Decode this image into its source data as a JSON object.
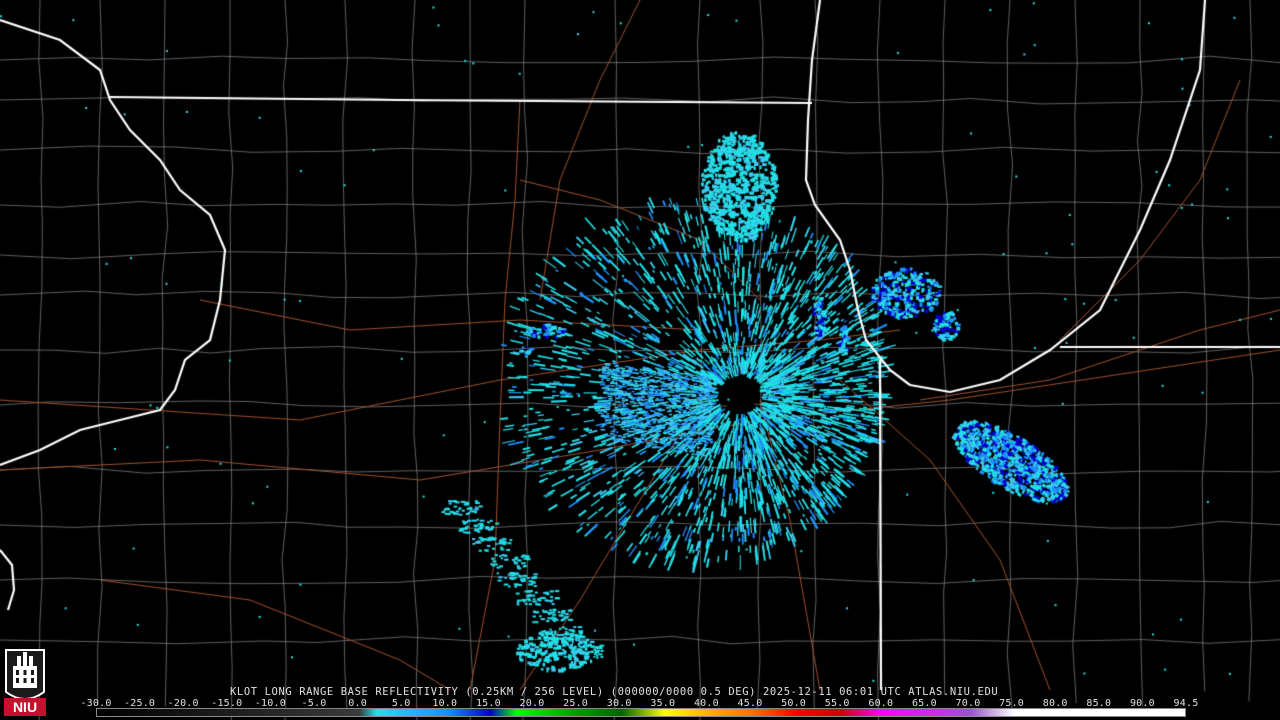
{
  "product": {
    "caption": "KLOT LONG RANGE BASE REFLECTIVITY (0.25KM / 256 LEVEL) (000000/0000 0.5 DEG) 2025-12-11 06:01 UTC  ATLAS.NIU.EDU"
  },
  "scale": {
    "ticks": [
      "-30.0",
      "-25.0",
      "-20.0",
      "-15.0",
      "-10.0",
      "-5.0",
      "0.0",
      "5.0",
      "10.0",
      "15.0",
      "20.0",
      "25.0",
      "30.0",
      "35.0",
      "40.0",
      "45.0",
      "50.0",
      "55.0",
      "60.0",
      "65.0",
      "70.0",
      "75.0",
      "80.0",
      "85.0",
      "90.0",
      "94.5"
    ],
    "stops": [
      {
        "dbz": -30,
        "color": "#000000"
      },
      {
        "dbz": 0,
        "color": "#3a3a3a"
      },
      {
        "dbz": 2,
        "color": "#22e0e8"
      },
      {
        "dbz": 10,
        "color": "#1e90ff"
      },
      {
        "dbz": 15,
        "color": "#0000cc"
      },
      {
        "dbz": 18,
        "color": "#00ff00"
      },
      {
        "dbz": 25,
        "color": "#009a00"
      },
      {
        "dbz": 30,
        "color": "#006400"
      },
      {
        "dbz": 35,
        "color": "#ffff00"
      },
      {
        "dbz": 40,
        "color": "#ffb000"
      },
      {
        "dbz": 45,
        "color": "#ff7000"
      },
      {
        "dbz": 50,
        "color": "#ff0000"
      },
      {
        "dbz": 55,
        "color": "#d00000"
      },
      {
        "dbz": 60,
        "color": "#ff00ff"
      },
      {
        "dbz": 70,
        "color": "#9955cc"
      },
      {
        "dbz": 75,
        "color": "#ffffff"
      },
      {
        "dbz": 94.5,
        "color": "#ffffff"
      }
    ]
  },
  "logo": {
    "text": "NIU",
    "color": "#c8102e"
  },
  "map": {
    "state_border_color": "#ffffff",
    "county_color": "#8a8a8a",
    "highway_color": "#a0522d",
    "echo_colors": [
      "#22e0e8",
      "#1e90ff",
      "#0000cc",
      "#3ec8f0"
    ]
  }
}
